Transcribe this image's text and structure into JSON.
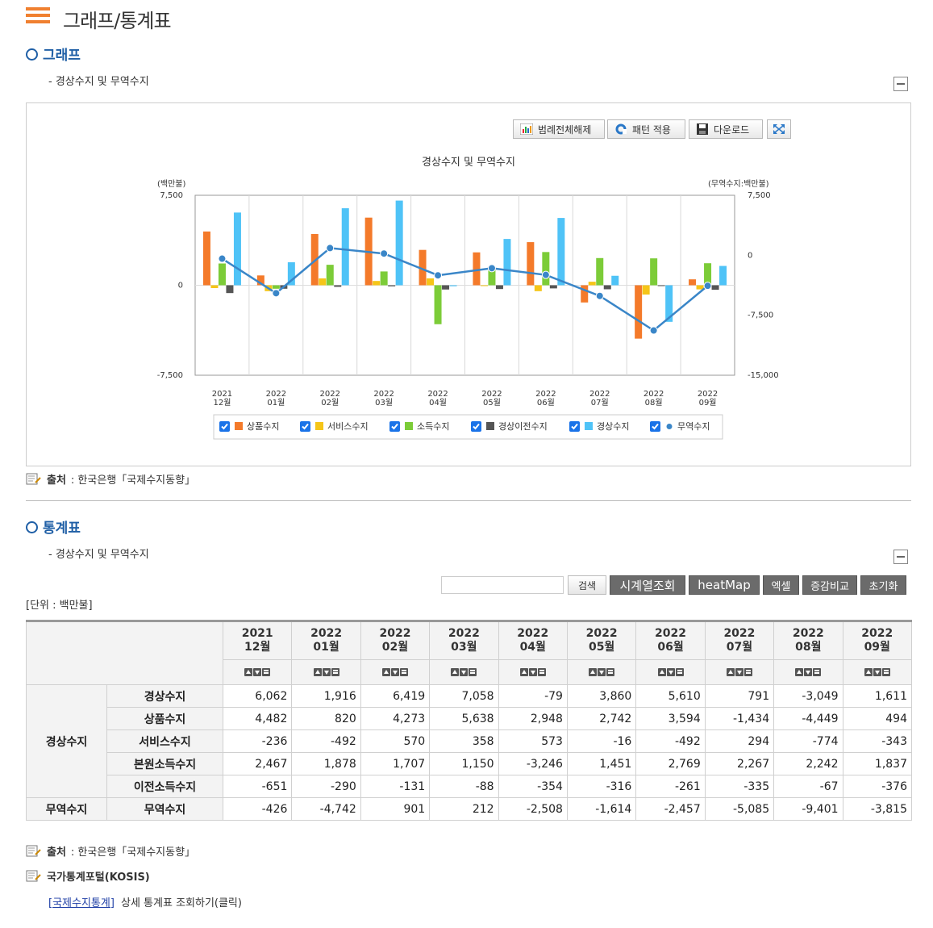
{
  "page_title": "그래프/통계표",
  "graph_section": {
    "title": "그래프",
    "subtitle": "- 경상수지 및 무역수지",
    "toolbar": {
      "legend_clear": "범례전체해제",
      "pattern_apply": "패턴 적용",
      "download": "다운로드"
    },
    "source_label": "출처",
    "source_text": ": 한국은행「국제수지동향」"
  },
  "chart_data": {
    "type": "bar",
    "title": "경상수지 및 무역수지",
    "left_axis_label": "(백만불)",
    "right_axis_label": "(무역수지:백만불)",
    "left_ticks": [
      "7,500",
      "0",
      "-7,500"
    ],
    "right_ticks": [
      "7,500",
      "0",
      "-7,500",
      "-15,000"
    ],
    "ylim_left": [
      -7500,
      7500
    ],
    "ylim_right": [
      -15000,
      7500
    ],
    "categories": [
      [
        "2021",
        "12월"
      ],
      [
        "2022",
        "01월"
      ],
      [
        "2022",
        "02월"
      ],
      [
        "2022",
        "03월"
      ],
      [
        "2022",
        "04월"
      ],
      [
        "2022",
        "05월"
      ],
      [
        "2022",
        "06월"
      ],
      [
        "2022",
        "07월"
      ],
      [
        "2022",
        "08월"
      ],
      [
        "2022",
        "09월"
      ]
    ],
    "series": [
      {
        "name": "상품수지",
        "color": "#f47a2a",
        "values": [
          4482,
          820,
          4273,
          5638,
          2948,
          2742,
          3594,
          -1434,
          -4449,
          494
        ]
      },
      {
        "name": "서비스수지",
        "color": "#f5c518",
        "values": [
          -236,
          -492,
          570,
          358,
          573,
          -16,
          -492,
          294,
          -774,
          -343
        ]
      },
      {
        "name": "소득수지",
        "color": "#7ccc38",
        "values": [
          1816,
          -290,
          1707,
          1150,
          -3246,
          1451,
          2769,
          2267,
          2242,
          1837
        ]
      },
      {
        "name": "경상이전수지",
        "color": "#555555",
        "values": [
          -651,
          -290,
          -131,
          -88,
          -354,
          -316,
          -261,
          -335,
          -67,
          -376
        ]
      },
      {
        "name": "경상수지",
        "color": "#4fc3f7",
        "values": [
          6062,
          1916,
          6419,
          7058,
          -79,
          3860,
          5610,
          791,
          -3049,
          1611
        ]
      }
    ],
    "line_series": {
      "name": "무역수지",
      "color": "#3a86c8",
      "values": [
        -426,
        -4742,
        901,
        212,
        -2508,
        -1614,
        -2457,
        -5085,
        -9401,
        -3815
      ]
    },
    "grid": true,
    "legend_position": "bottom"
  },
  "table_section": {
    "title": "통계표",
    "subtitle": "- 경상수지 및 무역수지",
    "search_button": "검색",
    "timeseries_button": "시계열조회",
    "heatmap_button": "heatMap",
    "excel_button": "엑셀",
    "compare_button": "증감비교",
    "reset_button": "초기화",
    "unit": "[단위 : 백만불]",
    "columns": [
      [
        "2021",
        "12월"
      ],
      [
        "2022",
        "01월"
      ],
      [
        "2022",
        "02월"
      ],
      [
        "2022",
        "03월"
      ],
      [
        "2022",
        "04월"
      ],
      [
        "2022",
        "05월"
      ],
      [
        "2022",
        "06월"
      ],
      [
        "2022",
        "07월"
      ],
      [
        "2022",
        "08월"
      ],
      [
        "2022",
        "09월"
      ]
    ],
    "groups": [
      {
        "name": "경상수지",
        "rows": [
          {
            "label": "경상수지",
            "values": [
              "6,062",
              "1,916",
              "6,419",
              "7,058",
              "-79",
              "3,860",
              "5,610",
              "791",
              "-3,049",
              "1,611"
            ]
          },
          {
            "label": "상품수지",
            "values": [
              "4,482",
              "820",
              "4,273",
              "5,638",
              "2,948",
              "2,742",
              "3,594",
              "-1,434",
              "-4,449",
              "494"
            ]
          },
          {
            "label": "서비스수지",
            "values": [
              "-236",
              "-492",
              "570",
              "358",
              "573",
              "-16",
              "-492",
              "294",
              "-774",
              "-343"
            ]
          },
          {
            "label": "본원소득수지",
            "values": [
              "2,467",
              "1,878",
              "1,707",
              "1,150",
              "-3,246",
              "1,451",
              "2,769",
              "2,267",
              "2,242",
              "1,837"
            ]
          },
          {
            "label": "이전소득수지",
            "values": [
              "-651",
              "-290",
              "-131",
              "-88",
              "-354",
              "-316",
              "-261",
              "-335",
              "-67",
              "-376"
            ]
          }
        ]
      },
      {
        "name": "무역수지",
        "rows": [
          {
            "label": "무역수지",
            "values": [
              "-426",
              "-4,742",
              "901",
              "212",
              "-2,508",
              "-1,614",
              "-2,457",
              "-5,085",
              "-9,401",
              "-3,815"
            ]
          }
        ]
      }
    ],
    "source_label": "출처",
    "source_text": ": 한국은행「국제수지동향」",
    "kosis_label": "국가통계포털(KOSIS)",
    "kosis_link": "[국제수지통계]",
    "kosis_desc": "상세 통계표 조회하기(클릭)"
  }
}
